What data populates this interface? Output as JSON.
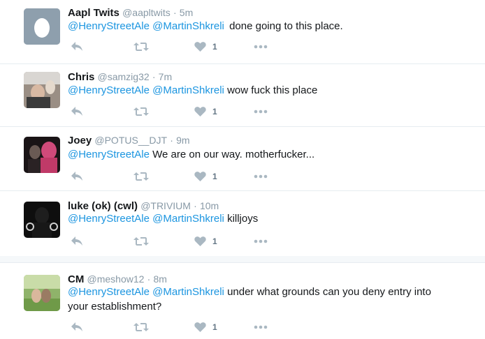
{
  "colors": {
    "mention": "#1b95e0",
    "name": "#14171a",
    "meta": "#8899a6",
    "icon": "#aab8c2",
    "divider": "#e6ecf0"
  },
  "tweets": [
    {
      "name": "Aapl Twits",
      "handle": "@aapltwits",
      "dot": "·",
      "time": "5m",
      "mentions": [
        "@HenryStreetAle",
        "@MartinShkreli"
      ],
      "body": "done going to this place.",
      "likes": "1",
      "avatar": "egg-avatar"
    },
    {
      "name": "Chris",
      "handle": "@samzig32",
      "dot": "·",
      "time": "7m",
      "mentions": [
        "@HenryStreetAle",
        "@MartinShkreli"
      ],
      "body": "wow fuck this place",
      "likes": "1",
      "avatar": "photo-avatar"
    },
    {
      "name": "Joey",
      "handle": "@POTUS__DJT",
      "dot": "·",
      "time": "9m",
      "mentions": [
        "@HenryStreetAle"
      ],
      "body": "We are on our way. motherfucker...",
      "likes": "1",
      "avatar": "photo-avatar"
    },
    {
      "name": "luke (ok) (cwl)",
      "handle": "@TRIVIUM",
      "dot": "·",
      "time": "10m",
      "mentions": [
        "@HenryStreetAle",
        "@MartinShkreli"
      ],
      "body": "killjoys",
      "likes": "1",
      "avatar": "photo-avatar"
    },
    {
      "name": "CM",
      "handle": "@meshow12",
      "dot": "·",
      "time": "8m",
      "mentions": [
        "@HenryStreetAle",
        "@MartinShkreli"
      ],
      "body": "under what grounds can you deny entry into",
      "body2": "your establishment?",
      "likes": "1",
      "avatar": "photo-avatar"
    }
  ]
}
